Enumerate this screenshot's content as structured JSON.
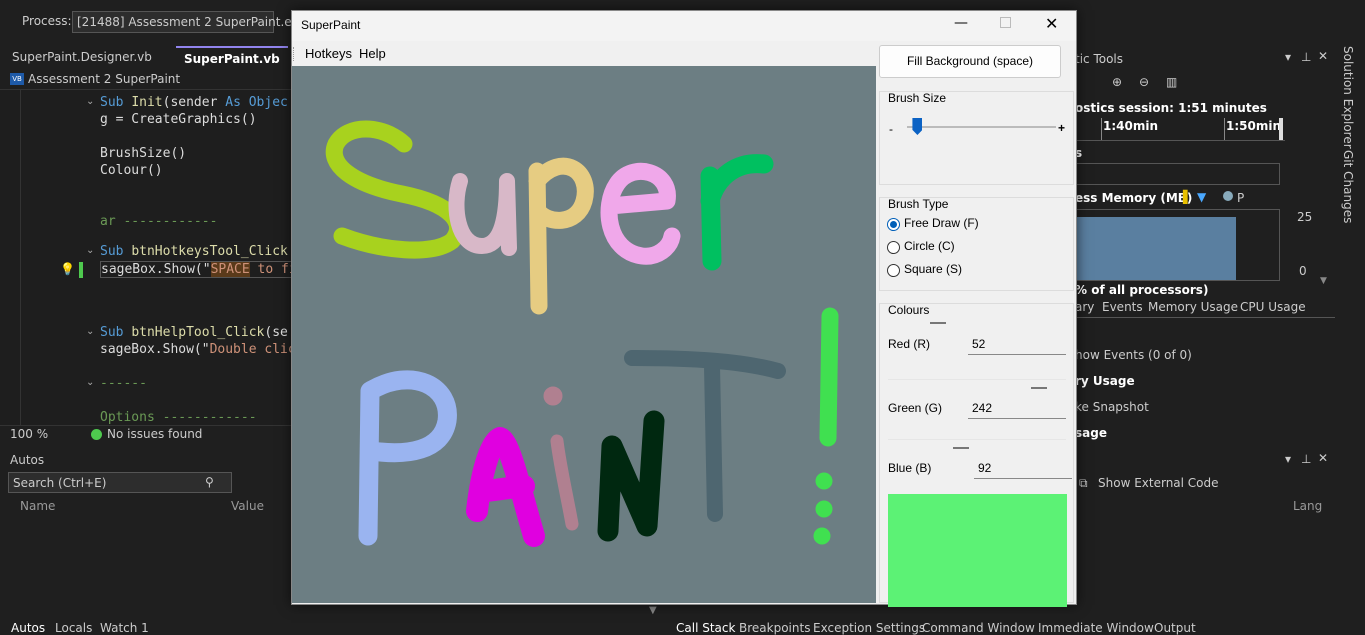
{
  "ide": {
    "process_label": "Process:",
    "process_value": "[21488] Assessment 2 SuperPaint.e",
    "tabs": [
      "SuperPaint.Designer.vb",
      "SuperPaint.vb"
    ],
    "solution_node": "Assessment 2 SuperPaint",
    "code_lines": {
      "l1a": "Sub ",
      "l1b": "Init",
      "l1c": "(sender ",
      "l1d": "As Objec",
      "l2": "g = CreateGraphics()",
      "l3": "BrushSize()",
      "l4": "Colour()",
      "l5": "ar ------------",
      "l6a": "Sub ",
      "l6b": "btnHotkeysTool_Click",
      "l7a": "sageBox.Show(\"",
      "l7b": "SPACE",
      "l7c": " to fi",
      "l8a": "Sub ",
      "l8b": "btnHelpTool_Click",
      "l8c": "(se",
      "l9a": "sageBox.Show(\"",
      "l9b": "Double click",
      "l10": "------",
      "l11": "Options ------------"
    },
    "zoom": "100 %",
    "issues": "No issues found",
    "autos_title": "Autos",
    "search_placeholder": "Search (Ctrl+E)",
    "col_name": "Name",
    "col_value": "Value",
    "bottom_tabs_left": [
      "Autos",
      "Locals",
      "Watch 1"
    ],
    "bottom_tabs_right": [
      "Call Stack",
      "Breakpoints",
      "Exception Settings",
      "Command Window",
      "Immediate Window",
      "Output"
    ],
    "diag_title": "tic Tools",
    "diag_session": "ostics session: 1:51 minutes",
    "time_1": "1:40min",
    "time_2": "1:50min",
    "events_label": "s",
    "memory_label": "ess Memory (MB)",
    "mem_max": "25",
    "mem_min": "0",
    "processors": "% of all processors)",
    "diag_tabs": [
      "ary",
      "Events",
      "Memory Usage",
      "CPU Usage"
    ],
    "show_events": "how Events (0 of 0)",
    "mem_usage": "ry Usage",
    "take_snapshot": "ke Snapshot",
    "sage": "sage",
    "show_external": "Show External Code",
    "lang": "Lang",
    "solution_explorer": "Solution Explorer",
    "git_changes": "Git Changes",
    "p_label": "P"
  },
  "app": {
    "title": "SuperPaint",
    "menu": [
      "Hotkeys",
      "Help"
    ],
    "fill_button": "Fill Background (space)",
    "brush_size_title": "Brush Size",
    "minus": "-",
    "plus": "+",
    "brush_size_fraction": 0.07,
    "brush_type_title": "Brush Type",
    "brush_types": [
      "Free Draw (F)",
      "Circle (C)",
      "Square (S)"
    ],
    "brush_type_selected": 0,
    "colours_title": "Colours",
    "red_label": "Red (R)",
    "red_value": "52",
    "green_label": "Green (G)",
    "green_value": "242",
    "blue_label": "Blue (B)",
    "blue_value": "92",
    "preview_color": "#5cf275",
    "canvas_color": "#6c7e83"
  },
  "drawing_colors": {
    "s": "#a8d21e",
    "u": "#d8b8c8",
    "p": "#e6cc82",
    "e": "#f0a8ea",
    "r": "#00c060",
    "P2": "#9ab4f0",
    "A": "#e000e0",
    "i": "#b08090",
    "N": "#002810",
    "T": "#4e6670",
    "bang": "#40e050"
  }
}
